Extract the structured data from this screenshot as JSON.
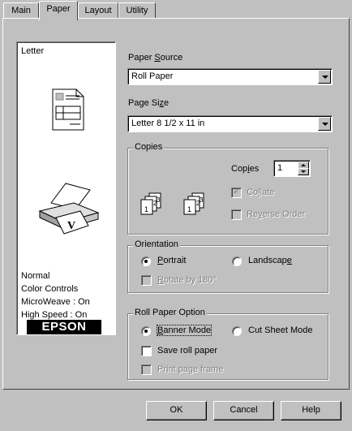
{
  "tabs": [
    {
      "label": "Main"
    },
    {
      "label": "Paper"
    },
    {
      "label": "Layout"
    },
    {
      "label": "Utility"
    }
  ],
  "preview": {
    "paper_label": "Letter",
    "status_lines": [
      "Normal",
      "Color Controls",
      "MicroWeave : On",
      "High Speed : On"
    ],
    "logo": "EPSON"
  },
  "paper_source": {
    "label": "Paper Source",
    "value": "Roll Paper"
  },
  "page_size": {
    "label": "Page Size",
    "value": "Letter 8 1/2 x 11 in"
  },
  "copies": {
    "group_title": "Copies",
    "copies_label": "Copies",
    "copies_value": "1",
    "collate_label": "Collate",
    "reverse_label": "Reverse Order"
  },
  "orientation": {
    "group_title": "Orientation",
    "portrait_label": "Portrait",
    "landscape_label": "Landscape",
    "rotate_label": "Rotate by 180°"
  },
  "roll_paper": {
    "group_title": "Roll Paper Option",
    "banner_label": "Banner Mode",
    "cut_sheet_label": "Cut Sheet Mode",
    "save_label": "Save roll paper",
    "frame_label": "Print page frame"
  },
  "buttons": {
    "ok": "OK",
    "cancel": "Cancel",
    "help": "Help"
  }
}
